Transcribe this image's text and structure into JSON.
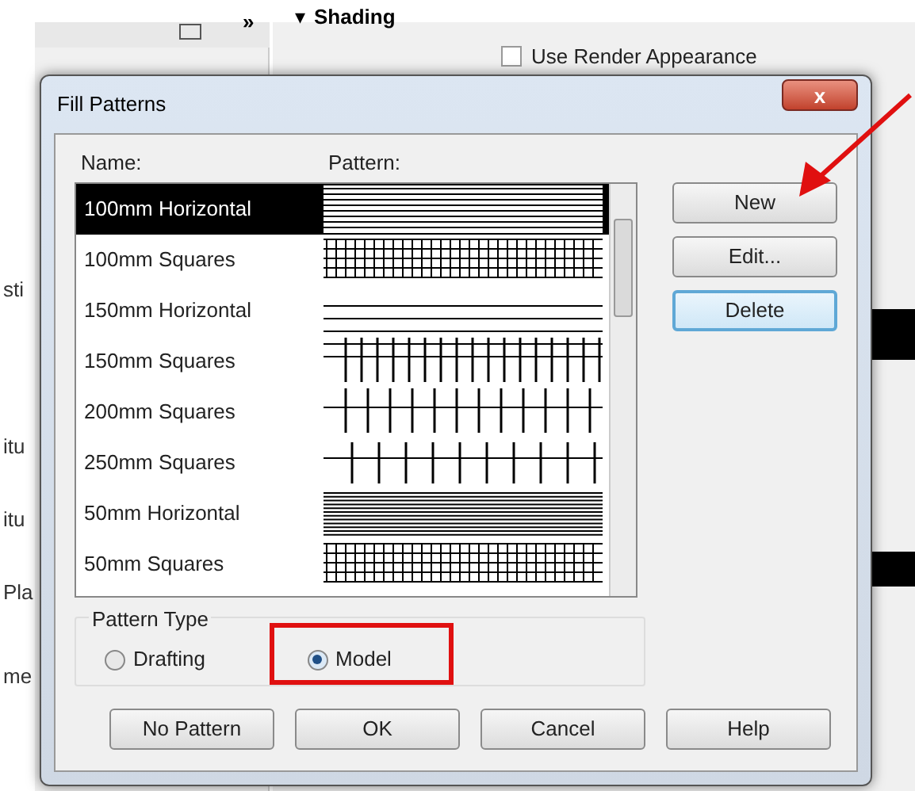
{
  "background": {
    "panel_toggle": "»",
    "section_marker": "▾",
    "section": "Shading",
    "checkbox": {
      "label": "Use Render Appearance",
      "checked": false
    },
    "cut_labels": [
      "sti",
      "itu",
      "itu",
      "Pla",
      "me"
    ]
  },
  "dialog": {
    "title": "Fill Patterns",
    "close": "x",
    "columns": [
      "Name:",
      "Pattern:"
    ],
    "rows": [
      {
        "name": "100mm Horizontal",
        "kind": "horizontal",
        "selected": true
      },
      {
        "name": "100mm Squares",
        "kind": "squares",
        "selected": false
      },
      {
        "name": "150mm Horizontal",
        "kind": "horizontal",
        "selected": false
      },
      {
        "name": "150mm Squares",
        "kind": "squares",
        "selected": false
      },
      {
        "name": "200mm Squares",
        "kind": "squares",
        "selected": false
      },
      {
        "name": "250mm Squares",
        "kind": "squares",
        "selected": false
      },
      {
        "name": "50mm Horizontal",
        "kind": "horizontal",
        "selected": false
      },
      {
        "name": "50mm Squares",
        "kind": "squares",
        "selected": false
      }
    ],
    "side_buttons": [
      {
        "label": "New",
        "focused": false
      },
      {
        "label": "Edit...",
        "focused": false
      },
      {
        "label": "Delete",
        "focused": true
      }
    ],
    "pattern_type": {
      "title": "Pattern Type",
      "options": [
        {
          "label": "Drafting",
          "selected": false
        },
        {
          "label": "Model",
          "selected": true
        }
      ]
    },
    "buttons": [
      "No Pattern",
      "OK",
      "Cancel",
      "Help"
    ]
  }
}
